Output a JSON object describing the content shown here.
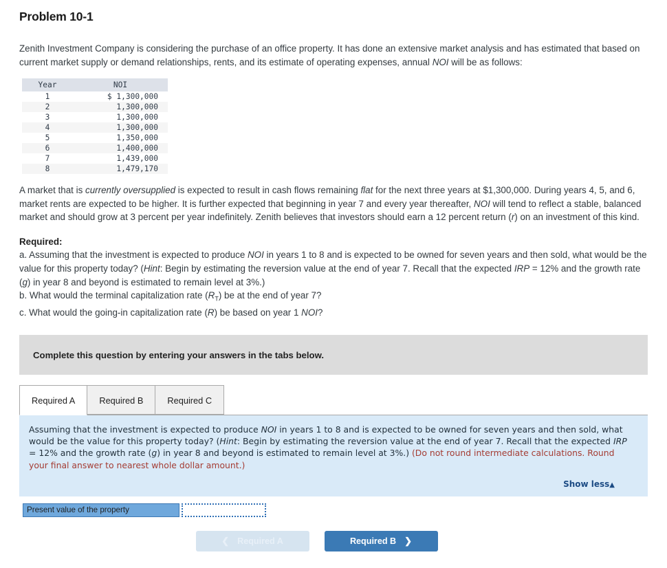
{
  "problem": {
    "title": "Problem 10-1",
    "intro_1": "Zenith Investment Company is considering the purchase of an office property. It has done an extensive market analysis and has estimated that based on current market supply or demand relationships, rents, and its estimate of operating expenses, annual ",
    "intro_1_italic": "NOI",
    "intro_1_end": " will be as follows:"
  },
  "noi_table": {
    "headers": [
      "Year",
      "NOI"
    ],
    "rows": [
      {
        "year": "1",
        "noi": "$ 1,300,000"
      },
      {
        "year": "2",
        "noi": "1,300,000"
      },
      {
        "year": "3",
        "noi": "1,300,000"
      },
      {
        "year": "4",
        "noi": "1,300,000"
      },
      {
        "year": "5",
        "noi": "1,350,000"
      },
      {
        "year": "6",
        "noi": "1,400,000"
      },
      {
        "year": "7",
        "noi": "1,439,000"
      },
      {
        "year": "8",
        "noi": "1,479,170"
      }
    ]
  },
  "market_paragraph": {
    "p1": "A market that is ",
    "i1": "currently oversupplied",
    "p2": " is expected to result in cash flows remaining ",
    "i2": "flat",
    "p3": " for the next three years at $1,300,000. During years 4, 5, and 6, market rents are expected to be higher. It is further expected that beginning in year 7 and every year thereafter, ",
    "i3": "NOI",
    "p4": " will tend to reflect a stable, balanced market and should grow at 3 percent per year indefinitely. Zenith believes that investors should earn a 12 percent return (",
    "i4": "r",
    "p5": ") on an investment of this kind."
  },
  "required": {
    "heading": "Required:",
    "a_1": "a. Assuming that the investment is expected to produce ",
    "a_i1": "NOI",
    "a_2": " in years 1 to 8 and is expected to be owned for seven years and then sold, what would be the value for this property today? (",
    "a_i2": "Hint",
    "a_3": ": Begin by estimating the reversion value at the end of year 7. Recall that the expected ",
    "a_i3": "IRP",
    "a_4": " = 12% and the growth rate (",
    "a_i4": "g",
    "a_5": ") in year 8 and beyond is estimated to remain level at 3%.)",
    "b_1": "b. What would the terminal capitalization rate (",
    "b_i1": "R",
    "b_sub": "T",
    "b_2": ") be at the end of year 7?",
    "c_1": "c. What would the going-in capitalization rate (",
    "c_i1": "R",
    "c_2": ") be based on year 1 ",
    "c_i2": "NOI",
    "c_3": "?"
  },
  "banner": {
    "text": "Complete this question by entering your answers in the tabs below."
  },
  "tabs": [
    {
      "label": "Required A",
      "active": true
    },
    {
      "label": "Required B",
      "active": false
    },
    {
      "label": "Required C",
      "active": false
    }
  ],
  "panel": {
    "t1": "Assuming that the investment is expected to produce ",
    "i1": "NOI",
    "t2": " in years 1 to 8 and is expected to be owned for seven years and then sold, what would be the value for this property today? (",
    "i2": "Hint",
    "t3": ": Begin by estimating the reversion value at the end of year 7. Recall that the expected ",
    "i3": "IRP",
    "t4": " = 12% and the growth rate (",
    "i4": "g",
    "t5": ") in year 8 and beyond is estimated to remain level at 3%.) ",
    "red": "(Do not round intermediate calculations. Round your final answer to nearest whole dollar amount.)",
    "show_less": "Show less",
    "show_less_caret": "▲"
  },
  "answer": {
    "label": "Present value of the property",
    "value": "",
    "placeholder": ""
  },
  "nav": {
    "prev_label": "Required A",
    "prev_chevron": "❮",
    "next_label": "Required B",
    "next_chevron": "❯"
  },
  "colors": {
    "banner_gray": "#dcdcdc",
    "panel_blue": "#d9eaf8",
    "accent_blue": "#3b7ab5",
    "label_blue": "#6fa8dc",
    "red_note": "#a43c33",
    "link_blue": "#1c4b84",
    "table_header": "#dde1e9"
  }
}
